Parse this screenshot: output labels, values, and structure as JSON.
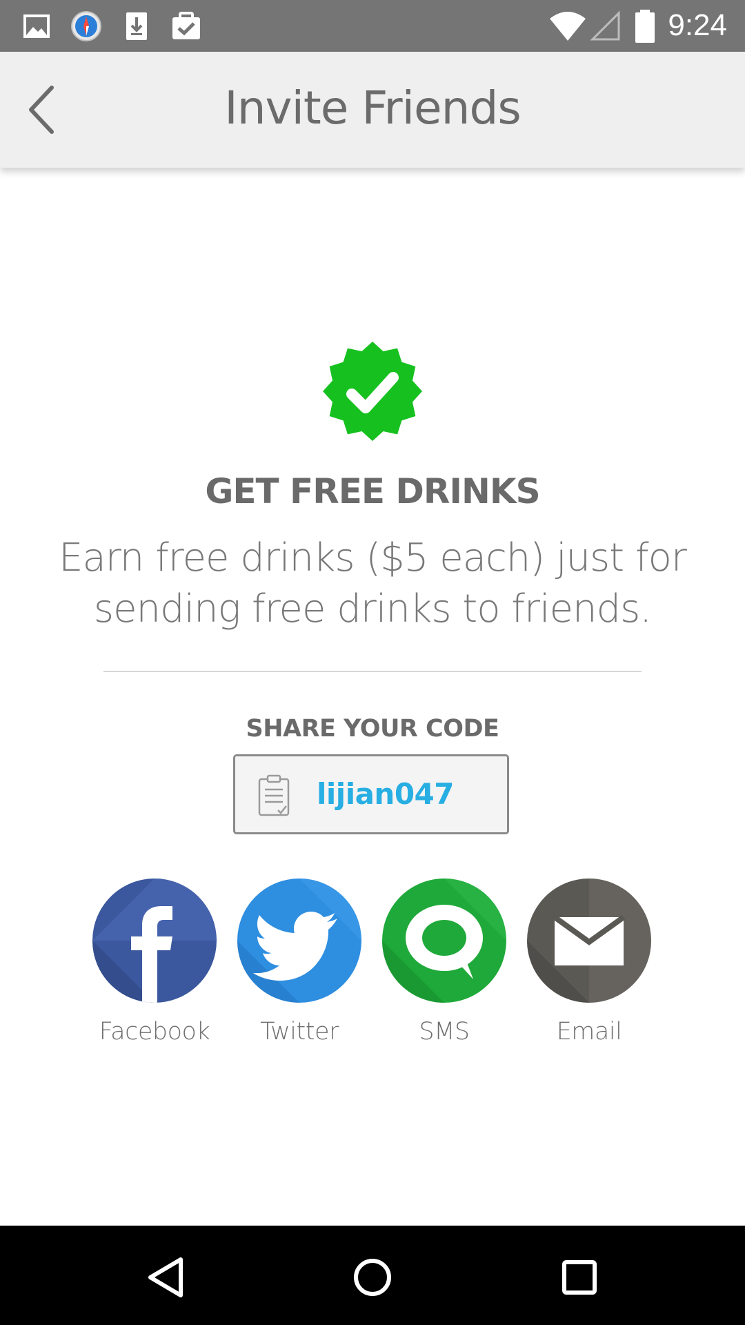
{
  "status_bar": {
    "time": "9:24",
    "icons": [
      "gallery-icon",
      "compass-icon",
      "download-icon",
      "clipboard-check-icon",
      "wifi-icon",
      "signal-icon",
      "battery-icon"
    ]
  },
  "app_bar": {
    "title": "Invite Friends",
    "back_icon": "chevron-left-icon"
  },
  "promo": {
    "badge_icon": "verified-badge-icon",
    "badge_color": "#16c11f",
    "headline": "GET FREE DRINKS",
    "description": "Earn free drinks ($5 each) just for sending free drinks to friends."
  },
  "share_code": {
    "label": "SHARE YOUR CODE",
    "code": "lijian047",
    "code_color": "#27aee2",
    "icon": "clipboard-icon"
  },
  "share_options": [
    {
      "label": "Facebook",
      "icon": "facebook-icon",
      "color": "#3b579d"
    },
    {
      "label": "Twitter",
      "icon": "twitter-icon",
      "color": "#2e8ee0"
    },
    {
      "label": "SMS",
      "icon": "chat-bubble-icon",
      "color": "#1fa93a"
    },
    {
      "label": "Email",
      "icon": "envelope-icon",
      "color": "#5b5954"
    }
  ],
  "nav_bar": {
    "icons": [
      "back-triangle-icon",
      "home-circle-icon",
      "recents-square-icon"
    ]
  }
}
